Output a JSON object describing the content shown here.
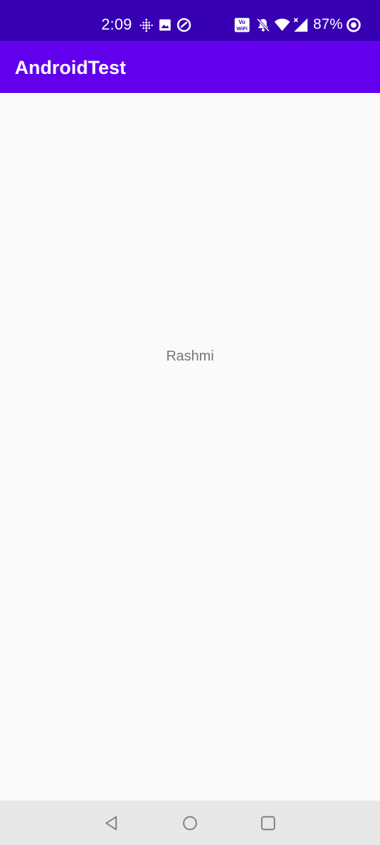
{
  "status_bar": {
    "time": "2:09",
    "battery_percent": "87%",
    "icons": [
      "fitbit-icon",
      "image-icon",
      "vpn-icon",
      "vowifi-icon",
      "mute-icon",
      "wifi-icon",
      "signal-icon",
      "battery-saver-icon"
    ],
    "vowifi_line1": "Vo",
    "vowifi_line2": "WiFi"
  },
  "app_bar": {
    "title": "AndroidTest"
  },
  "content": {
    "text": "Rashmi"
  },
  "nav_bar": {
    "buttons": [
      "back-icon",
      "home-icon",
      "recents-icon"
    ]
  },
  "colors": {
    "status_bar": "#3700b3",
    "app_bar": "#6200ee",
    "background": "#fafafa",
    "text": "#757575",
    "nav_bar": "#e8e8e8"
  }
}
